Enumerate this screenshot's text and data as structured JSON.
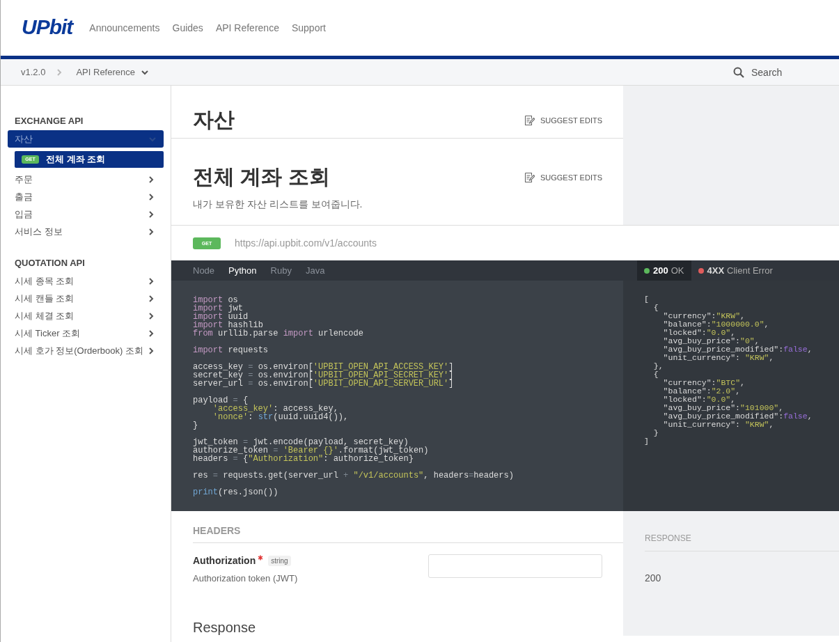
{
  "header": {
    "logo": "UPbit",
    "nav": [
      "Announcements",
      "Guides",
      "API Reference",
      "Support"
    ]
  },
  "breadcrumb": {
    "version": "v1.2.0",
    "section": "API Reference",
    "search": {
      "placeholder": "Search"
    }
  },
  "sidebar": {
    "sections": [
      {
        "title": "EXCHANGE API",
        "items": [
          {
            "label": "자산",
            "expanded": true,
            "selected": true,
            "children": [
              {
                "method": "GET",
                "label": "전체 계좌 조회",
                "selected": true
              }
            ]
          },
          {
            "label": "주문",
            "expanded": false,
            "selected": false
          },
          {
            "label": "출금",
            "expanded": false,
            "selected": false
          },
          {
            "label": "입금",
            "expanded": false,
            "selected": false
          },
          {
            "label": "서비스 정보",
            "expanded": false,
            "selected": false
          }
        ]
      },
      {
        "title": "QUOTATION API",
        "items": [
          {
            "label": "시세 종목 조회",
            "expanded": false,
            "selected": false
          },
          {
            "label": "시세 캔들 조회",
            "expanded": false,
            "selected": false
          },
          {
            "label": "시세 체결 조회",
            "expanded": false,
            "selected": false
          },
          {
            "label": "시세 Ticker 조회",
            "expanded": false,
            "selected": false
          },
          {
            "label": "시세 호가 정보(Orderbook) 조회",
            "expanded": false,
            "selected": false
          }
        ]
      }
    ]
  },
  "page": {
    "section_title": "자산",
    "section_edit": "SUGGEST EDITS",
    "title": "전체 계좌 조회",
    "title_edit": "SUGGEST EDITS",
    "description": "내가 보유한 자산 리스트를 보여줍니다.",
    "method": "GET",
    "url": "https://api.upbit.com/v1/accounts"
  },
  "code": {
    "tabs": [
      {
        "label": "Node",
        "selected": false
      },
      {
        "label": "Python",
        "selected": true
      },
      {
        "label": "Ruby",
        "selected": false
      },
      {
        "label": "Java",
        "selected": false
      }
    ],
    "blocks": [
      [
        [
          {
            "kind": "kw",
            "text": "import"
          },
          {
            "kind": "plain",
            "text": " os"
          }
        ],
        [
          {
            "kind": "kw",
            "text": "import"
          },
          {
            "kind": "plain",
            "text": " jwt"
          }
        ],
        [
          {
            "kind": "kw",
            "text": "import"
          },
          {
            "kind": "plain",
            "text": " uuid"
          }
        ],
        [
          {
            "kind": "kw",
            "text": "import"
          },
          {
            "kind": "plain",
            "text": " hashlib"
          }
        ],
        [
          {
            "kind": "kw",
            "text": "from"
          },
          {
            "kind": "plain",
            "text": " urllib.parse "
          },
          {
            "kind": "kw",
            "text": "import"
          },
          {
            "kind": "plain",
            "text": " urlencode"
          }
        ]
      ],
      [
        [
          {
            "kind": "kw",
            "text": "import"
          },
          {
            "kind": "plain",
            "text": " requests"
          }
        ]
      ],
      [
        [
          {
            "kind": "plain",
            "text": "access_key"
          },
          {
            "kind": "op",
            "text": " = "
          },
          {
            "kind": "plain",
            "text": "os.environ["
          },
          {
            "kind": "str",
            "text": "'UPBIT_OPEN_API_ACCESS_KEY'"
          },
          {
            "kind": "plain",
            "text": "]"
          }
        ],
        [
          {
            "kind": "plain",
            "text": "secret_key"
          },
          {
            "kind": "op",
            "text": " = "
          },
          {
            "kind": "plain",
            "text": "os.environ["
          },
          {
            "kind": "str",
            "text": "'UPBIT_OPEN_API_SECRET_KEY'"
          },
          {
            "kind": "plain",
            "text": "]"
          }
        ],
        [
          {
            "kind": "plain",
            "text": "server_url"
          },
          {
            "kind": "op",
            "text": " = "
          },
          {
            "kind": "plain",
            "text": "os.environ["
          },
          {
            "kind": "str",
            "text": "'UPBIT_OPEN_API_SERVER_URL'"
          },
          {
            "kind": "plain",
            "text": "]"
          }
        ]
      ],
      [
        [
          {
            "kind": "plain",
            "text": "payload"
          },
          {
            "kind": "op",
            "text": " = "
          },
          {
            "kind": "plain",
            "text": "{"
          }
        ],
        [
          {
            "kind": "str",
            "text": "    'access_key'"
          },
          {
            "kind": "plain",
            "text": ": access_key,"
          }
        ],
        [
          {
            "kind": "str",
            "text": "    'nonce'"
          },
          {
            "kind": "plain",
            "text": ": "
          },
          {
            "kind": "fn",
            "text": "str"
          },
          {
            "kind": "plain",
            "text": "(uuid.uuid4()),"
          }
        ],
        [
          {
            "kind": "plain",
            "text": "}"
          }
        ]
      ],
      [
        [
          {
            "kind": "plain",
            "text": "jwt_token"
          },
          {
            "kind": "op",
            "text": " = "
          },
          {
            "kind": "plain",
            "text": "jwt.encode(payload, secret_key)"
          }
        ],
        [
          {
            "kind": "plain",
            "text": "authorize_token"
          },
          {
            "kind": "op",
            "text": " = "
          },
          {
            "kind": "str",
            "text": "'Bearer {}'"
          },
          {
            "kind": "plain",
            "text": ".format(jwt_token)"
          }
        ],
        [
          {
            "kind": "plain",
            "text": "headers"
          },
          {
            "kind": "op",
            "text": " = "
          },
          {
            "kind": "plain",
            "text": "{"
          },
          {
            "kind": "str",
            "text": "\"Authorization\""
          },
          {
            "kind": "plain",
            "text": ": authorize_token}"
          }
        ]
      ],
      [
        [
          {
            "kind": "plain",
            "text": "res"
          },
          {
            "kind": "op",
            "text": " = "
          },
          {
            "kind": "plain",
            "text": "requests.get(server_url"
          },
          {
            "kind": "op",
            "text": " + "
          },
          {
            "kind": "str",
            "text": "\"/v1/accounts\""
          },
          {
            "kind": "plain",
            "text": ", headers"
          },
          {
            "kind": "op",
            "text": "="
          },
          {
            "kind": "plain",
            "text": "headers)"
          }
        ]
      ],
      [
        [
          {
            "kind": "fn",
            "text": "print"
          },
          {
            "kind": "plain",
            "text": "(res.json())"
          }
        ]
      ]
    ]
  },
  "response_example": {
    "tabs": [
      {
        "code": "200",
        "label": "OK",
        "color": "#5cb85c",
        "selected": true
      },
      {
        "code": "4XX",
        "label": "Client Error",
        "color": "#e05c5c",
        "selected": false
      }
    ],
    "lines": [
      [
        {
          "kind": "plain",
          "text": "["
        }
      ],
      [
        {
          "kind": "plain",
          "text": "  {"
        }
      ],
      [
        {
          "kind": "plain",
          "text": "    \"currency\":"
        },
        {
          "kind": "str",
          "text": "\"KRW\""
        },
        {
          "kind": "plain",
          "text": ","
        }
      ],
      [
        {
          "kind": "plain",
          "text": "    \"balance\":"
        },
        {
          "kind": "str",
          "text": "\"1000000.0\""
        },
        {
          "kind": "plain",
          "text": ","
        }
      ],
      [
        {
          "kind": "plain",
          "text": "    \"locked\":"
        },
        {
          "kind": "str",
          "text": "\"0.0\""
        },
        {
          "kind": "plain",
          "text": ","
        }
      ],
      [
        {
          "kind": "plain",
          "text": "    \"avg_buy_price\":"
        },
        {
          "kind": "str",
          "text": "\"0\""
        },
        {
          "kind": "plain",
          "text": ","
        }
      ],
      [
        {
          "kind": "plain",
          "text": "    \"avg_buy_price_modified\":"
        },
        {
          "kind": "bool",
          "text": "false"
        },
        {
          "kind": "plain",
          "text": ","
        }
      ],
      [
        {
          "kind": "plain",
          "text": "    \"unit_currency\": "
        },
        {
          "kind": "str",
          "text": "\"KRW\""
        },
        {
          "kind": "plain",
          "text": ","
        }
      ],
      [
        {
          "kind": "plain",
          "text": "  },"
        }
      ],
      [
        {
          "kind": "plain",
          "text": "  {"
        }
      ],
      [
        {
          "kind": "plain",
          "text": "    \"currency\":"
        },
        {
          "kind": "str",
          "text": "\"BTC\""
        },
        {
          "kind": "plain",
          "text": ","
        }
      ],
      [
        {
          "kind": "plain",
          "text": "    \"balance\":"
        },
        {
          "kind": "str",
          "text": "\"2.0\""
        },
        {
          "kind": "plain",
          "text": ","
        }
      ],
      [
        {
          "kind": "plain",
          "text": "    \"locked\":"
        },
        {
          "kind": "str",
          "text": "\"0.0\""
        },
        {
          "kind": "plain",
          "text": ","
        }
      ],
      [
        {
          "kind": "plain",
          "text": "    \"avg_buy_price\":"
        },
        {
          "kind": "str",
          "text": "\"101000\""
        },
        {
          "kind": "plain",
          "text": ","
        }
      ],
      [
        {
          "kind": "plain",
          "text": "    \"avg_buy_price_modified\":"
        },
        {
          "kind": "bool",
          "text": "false"
        },
        {
          "kind": "plain",
          "text": ","
        }
      ],
      [
        {
          "kind": "plain",
          "text": "    \"unit_currency\": "
        },
        {
          "kind": "str",
          "text": "\"KRW\""
        },
        {
          "kind": "plain",
          "text": ","
        }
      ],
      [
        {
          "kind": "plain",
          "text": "  }"
        }
      ],
      [
        {
          "kind": "plain",
          "text": "]"
        }
      ]
    ]
  },
  "headers": {
    "title": "HEADERS",
    "params": [
      {
        "name": "Authorization",
        "required": true,
        "type": "string",
        "description": "Authorization token (JWT)"
      }
    ]
  },
  "response": {
    "title": "RESPONSE",
    "status": "200"
  },
  "response_section": {
    "title": "Response"
  }
}
